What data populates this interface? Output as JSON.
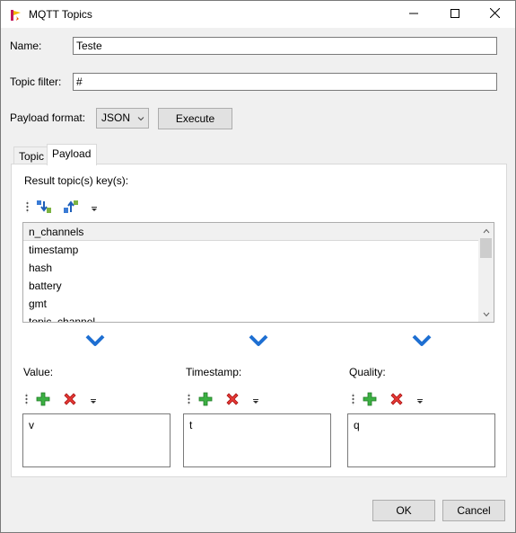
{
  "window": {
    "title": "MQTT Topics"
  },
  "form": {
    "name_label": "Name:",
    "name_value": "Teste",
    "topic_filter_label": "Topic filter:",
    "topic_filter_value": "#",
    "payload_format_label": "Payload format:",
    "payload_format_value": "JSON",
    "execute_label": "Execute"
  },
  "tabs": [
    {
      "label": "Topic",
      "active": false
    },
    {
      "label": "Payload",
      "active": true
    }
  ],
  "payload": {
    "result_keys_label": "Result topic(s) key(s):",
    "keys": [
      "n_channels",
      "timestamp",
      "hash",
      "battery",
      "gmt",
      "topic_channel"
    ],
    "selected_key": "n_channels",
    "value": {
      "label": "Value:",
      "text": "v"
    },
    "timestamp": {
      "label": "Timestamp:",
      "text": "t"
    },
    "quality": {
      "label": "Quality:",
      "text": "q"
    }
  },
  "footer": {
    "ok_label": "OK",
    "cancel_label": "Cancel"
  },
  "colors": {
    "chevron": "#1e6fd2",
    "add": "#2ea62e",
    "remove": "#d62a2a"
  },
  "icons": [
    "app-icon",
    "minimize-icon",
    "maximize-icon",
    "close-icon",
    "sort-down-icon",
    "sort-up-icon",
    "add-icon",
    "remove-icon",
    "chevron-down-icon"
  ]
}
